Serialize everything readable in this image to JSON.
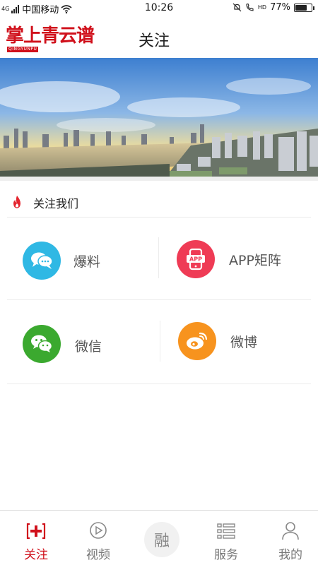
{
  "status_bar": {
    "network": "4G",
    "carrier": "中国移动",
    "time": "10:26",
    "volte": "HD",
    "battery_percent": "77%",
    "battery_level": 0.77
  },
  "header": {
    "logo_text": "掌上青云谱",
    "logo_subtext": "QINGYUNPU",
    "title": "关注"
  },
  "follow": {
    "section_title": "关注我们",
    "items": [
      {
        "label": "爆料",
        "icon": "chat-bubbles-icon",
        "color": "#2fb8e4"
      },
      {
        "label": "APP矩阵",
        "icon": "app-phone-icon",
        "color": "#ef3b55"
      },
      {
        "label": "微信",
        "icon": "wechat-icon",
        "color": "#3ba92f"
      },
      {
        "label": "微博",
        "icon": "weibo-icon",
        "color": "#f7931e"
      }
    ]
  },
  "tabs": [
    {
      "label": "关注",
      "icon": "plus-bracket-icon",
      "active": true
    },
    {
      "label": "视频",
      "icon": "play-icon",
      "active": false
    },
    {
      "label": "融",
      "icon": "fusion-icon",
      "active": false
    },
    {
      "label": "服务",
      "icon": "list-icon",
      "active": false
    },
    {
      "label": "我的",
      "icon": "user-icon",
      "active": false
    }
  ],
  "colors": {
    "brand_red": "#d0101b",
    "divider": "#ececec"
  }
}
